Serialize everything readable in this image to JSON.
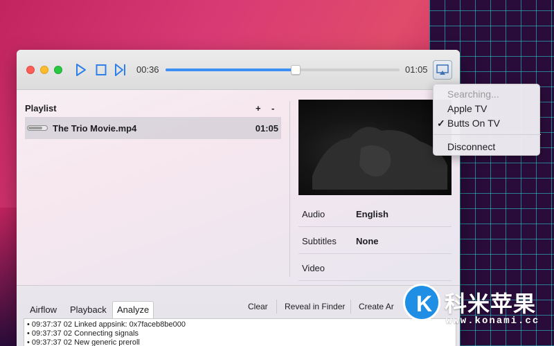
{
  "player": {
    "elapsed": "00:36",
    "total": "01:05",
    "progress_fraction": 0.555
  },
  "playlist": {
    "title": "Playlist",
    "add_label": "+",
    "remove_label": "-",
    "items": [
      {
        "name": "The Trio Movie.mp4",
        "duration": "01:05"
      }
    ]
  },
  "info": {
    "rows": [
      {
        "label": "Audio",
        "value": "English"
      },
      {
        "label": "Subtitles",
        "value": "None"
      },
      {
        "label": "Video",
        "value": ""
      }
    ]
  },
  "tabs": [
    "Airflow",
    "Playback",
    "Analyze"
  ],
  "active_tab": "Analyze",
  "actions": {
    "clear": "Clear",
    "reveal": "Reveal in Finder",
    "create": "Create Ar"
  },
  "log": [
    "09:37:37 02 Linked appsink: 0x7faceb8be000",
    "09:37:37 02 Connecting signals",
    "09:37:37 02 New generic preroll"
  ],
  "airplay_menu": {
    "searching": "Searching...",
    "devices": [
      "Apple TV",
      "Butts On TV"
    ],
    "selected": "Butts On TV",
    "check_mark": "✓",
    "disconnect": "Disconnect"
  },
  "watermark": {
    "logo_letter": "K",
    "text": "科米苹果",
    "url": "www.konami.cc"
  },
  "colors": {
    "accent": "#3d8ef5",
    "close": "#fc5f57",
    "minimize": "#fdbc2e",
    "zoom": "#28c840"
  }
}
